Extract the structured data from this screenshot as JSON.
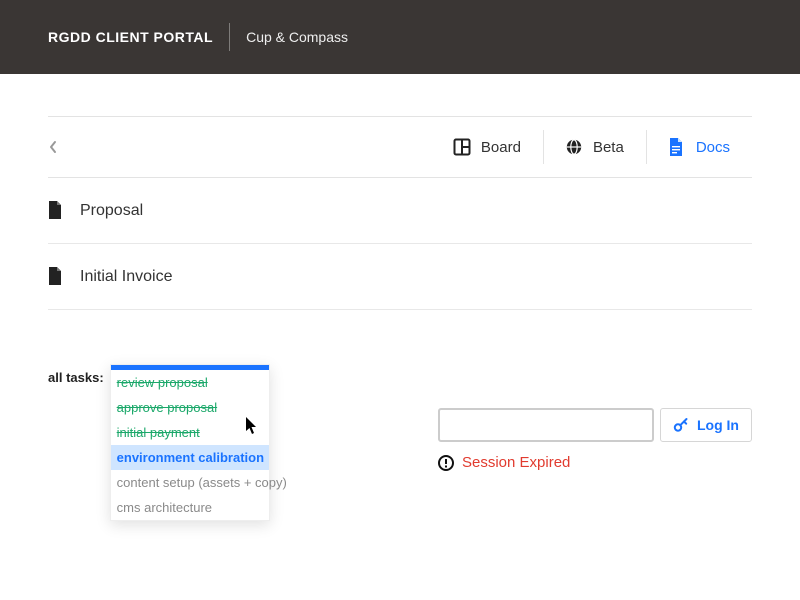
{
  "header": {
    "brand": "RGDD CLIENT PORTAL",
    "client": "Cup & Compass"
  },
  "tabs": {
    "board": "Board",
    "beta": "Beta",
    "docs": "Docs",
    "active": "docs"
  },
  "documents": [
    {
      "title": "Proposal"
    },
    {
      "title": "Initial Invoice"
    }
  ],
  "tasks": {
    "label": "all tasks:",
    "items": [
      {
        "label": "review proposal",
        "state": "done"
      },
      {
        "label": "approve proposal",
        "state": "done"
      },
      {
        "label": "initial payment",
        "state": "done"
      },
      {
        "label": "environment calibration",
        "state": "selected"
      },
      {
        "label": "content setup (assets + copy)",
        "state": "pending"
      },
      {
        "label": "cms architecture",
        "state": "pending"
      }
    ]
  },
  "login": {
    "button": "Log In",
    "placeholder": ""
  },
  "session": {
    "message": "Session Expired"
  }
}
